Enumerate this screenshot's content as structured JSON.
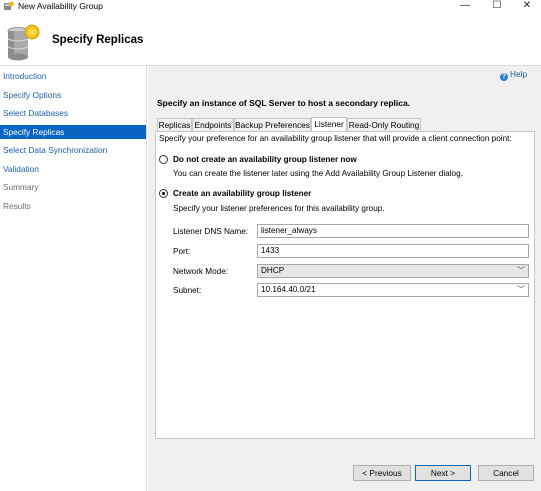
{
  "window": {
    "title": "New Availability Group",
    "minimize_glyph": "—",
    "maximize_glyph": "☐",
    "close_glyph": "✕"
  },
  "header": {
    "title": "Specify Replicas"
  },
  "sidebar": {
    "items": [
      {
        "label": "Introduction",
        "state": "link"
      },
      {
        "label": "Specify Options",
        "state": "link"
      },
      {
        "label": "Select Databases",
        "state": "link"
      },
      {
        "label": "Specify Replicas",
        "state": "active"
      },
      {
        "label": "Select Data Synchronization",
        "state": "link"
      },
      {
        "label": "Validation",
        "state": "link"
      },
      {
        "label": "Summary",
        "state": "disabled"
      },
      {
        "label": "Results",
        "state": "disabled"
      }
    ]
  },
  "main": {
    "help_label": "Help",
    "instruction": "Specify an instance of SQL Server to host a secondary replica.",
    "tabs": [
      {
        "label": "Replicas",
        "active": false
      },
      {
        "label": "Endpoints",
        "active": false
      },
      {
        "label": "Backup Preferences",
        "active": false
      },
      {
        "label": "Listener",
        "active": true
      },
      {
        "label": "Read-Only Routing",
        "active": false
      }
    ],
    "listener": {
      "intro": "Specify your preference for an availability group listener that will provide a client connection point:",
      "option_no": {
        "label": "Do not create an availability group listener now",
        "hint": "You can create the listener later using the Add Availability Group Listener dialog.",
        "selected": false
      },
      "option_yes": {
        "label": "Create an availability group listener",
        "hint": "Specify your listener preferences for this availability group.",
        "selected": true
      },
      "dns_name": {
        "label": "Listener DNS Name:",
        "value": "listener_always"
      },
      "port": {
        "label": "Port:",
        "value": "1433"
      },
      "network_mode": {
        "label": "Network Mode:",
        "value": "DHCP"
      },
      "subnet": {
        "label": "Subnet:",
        "value": "10.164.40.0/21"
      }
    }
  },
  "footer": {
    "previous_label": "< Previous",
    "next_label": "Next >",
    "cancel_label": "Cancel"
  },
  "colors": {
    "accent": "#0a64c2",
    "link": "#1f5fa8",
    "panel_bg": "#f0f0f0"
  },
  "icons": {
    "app": "availability-group-icon",
    "header": "database-stack-icon",
    "help": "help-icon",
    "dropdown": "chevron-down-icon"
  }
}
